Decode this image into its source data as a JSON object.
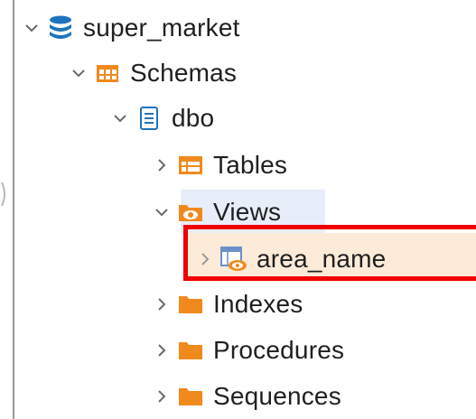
{
  "colors": {
    "folder_orange": "#f08a1d",
    "db_blue": "#1e73be",
    "chevron": "#6a6a6a",
    "selection_bg": "#e8eef9",
    "hover_bg": "#fdebd9",
    "highlight_red": "#ee0000"
  },
  "tree": {
    "database": {
      "label": "super_market",
      "icon": "database-icon",
      "expanded": true
    },
    "schemas": {
      "label": "Schemas",
      "icon": "schemas-icon",
      "expanded": true
    },
    "schema": {
      "label": "dbo",
      "icon": "schema-icon",
      "expanded": true
    },
    "tables": {
      "label": "Tables",
      "icon": "table-folder-icon",
      "expanded": false
    },
    "views": {
      "label": "Views",
      "icon": "view-folder-icon",
      "expanded": true,
      "selected": true
    },
    "view_item": {
      "label": "area_name",
      "icon": "view-icon",
      "expanded": false,
      "highlighted": true
    },
    "indexes": {
      "label": "Indexes",
      "icon": "folder-icon",
      "expanded": false
    },
    "procedures": {
      "label": "Procedures",
      "icon": "folder-icon",
      "expanded": false
    },
    "sequences": {
      "label": "Sequences",
      "icon": "folder-icon",
      "expanded": false
    }
  }
}
